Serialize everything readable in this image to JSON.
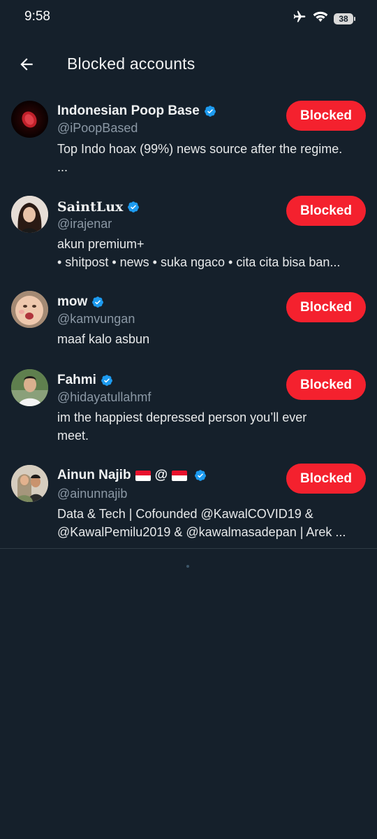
{
  "status_bar": {
    "time": "9:58",
    "battery": "38",
    "icons": [
      "airplane-icon",
      "wifi-icon",
      "battery-icon"
    ]
  },
  "header": {
    "title": "Blocked accounts",
    "back_icon": "arrow-left-icon"
  },
  "colors": {
    "background": "#15202b",
    "blocked_button": "#f4212e",
    "verified": "#1d9bf0",
    "handle": "#8b98a5"
  },
  "accounts": [
    {
      "name": "Indonesian Poop Base",
      "handle": "@iPoopBased",
      "bio_lines": [
        "Top Indo hoax (99%) news source after the regime.",
        "..."
      ],
      "button": "Blocked",
      "verified": true
    },
    {
      "name": "SaintLux",
      "handle": "@irajenar",
      "bio_lines": [
        "akun premium+",
        "• shitpost • news • suka ngaco • cita cita bisa ban..."
      ],
      "button": "Blocked",
      "verified": true
    },
    {
      "name": "mow",
      "handle": "@kamvungan",
      "bio_lines": [
        "maaf kalo asbun"
      ],
      "button": "Blocked",
      "verified": true
    },
    {
      "name": "Fahmi",
      "handle": "@hidayatullahmf",
      "bio_lines": [
        "im the happiest depressed person you’ll ever",
        "meet."
      ],
      "button": "Blocked",
      "verified": true
    },
    {
      "name_prefix": "Ainun Najib",
      "name_separator": "@",
      "handle": "@ainunnajib",
      "bio_lines": [
        "Data & Tech | Cofounded @KawalCOVID19 &",
        "@KawalPemilu2019 & @kawalmasadepan | Arek ..."
      ],
      "button": "Blocked",
      "verified": true
    }
  ]
}
